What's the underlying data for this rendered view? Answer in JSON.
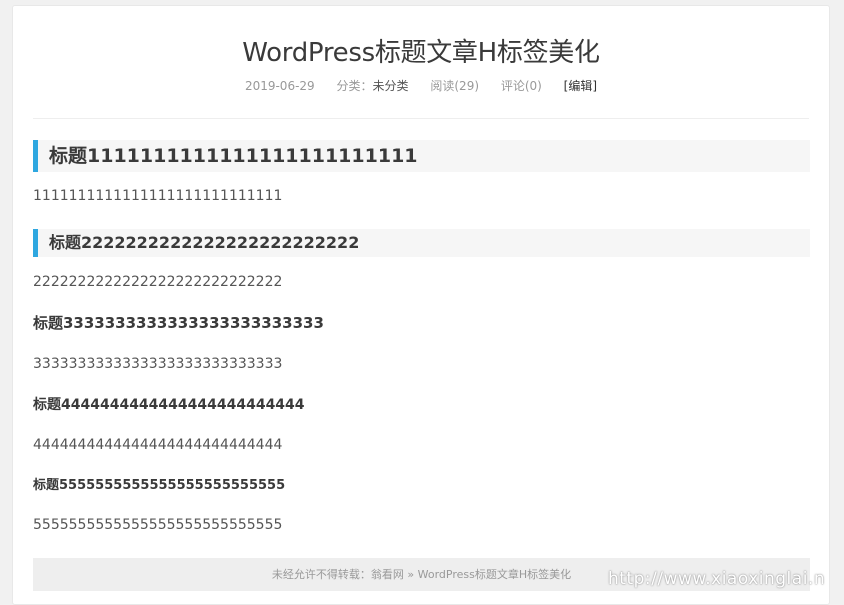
{
  "post": {
    "title": "WordPress标题文章H标签美化",
    "meta": {
      "date": "2019-06-29",
      "category_label": "分类：",
      "category_value": "未分类",
      "reads": "阅读(29)",
      "comments": "评论(0)",
      "edit": "[编辑]"
    },
    "content": {
      "h2_1": "标题1111111111111111111111111",
      "p1": "1111111111111111111111111111",
      "h2_2": "标题2222222222222222222222222",
      "p2": "2222222222222222222222222222",
      "h3": "标题3333333333333333333333333",
      "p3": "3333333333333333333333333333",
      "h4": "标题4444444444444444444444444",
      "p4": "4444444444444444444444444444",
      "h5": "标题5555555555555555555555555",
      "p5": "5555555555555555555555555555"
    },
    "copyright": "未经允许不得转载：翁看网 » WordPress标题文章H标签美化"
  },
  "watermark": "http://www.xiaoxinglai.n",
  "colors": {
    "accent": "#2ea7e0",
    "heading_bg": "#f6f6f6",
    "page_bg": "#f1f1f1"
  }
}
